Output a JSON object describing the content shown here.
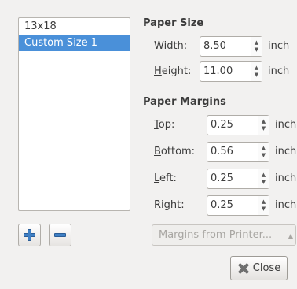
{
  "sizes": [
    {
      "label": "13x18",
      "selected": false
    },
    {
      "label": "Custom Size 1",
      "selected": true
    }
  ],
  "paper_size": {
    "heading": "Paper Size",
    "width": {
      "label_accel": "W",
      "label_rest": "idth:",
      "value": "8.50",
      "unit": "inch"
    },
    "height": {
      "label_accel": "H",
      "label_rest": "eight:",
      "value": "11.00",
      "unit": "inch"
    }
  },
  "paper_margins": {
    "heading": "Paper Margins",
    "top": {
      "label_accel": "T",
      "label_rest": "op:",
      "value": "0.25",
      "unit": "inch"
    },
    "bottom": {
      "label_accel": "B",
      "label_rest": "ottom:",
      "value": "0.56",
      "unit": "inch"
    },
    "left": {
      "label_accel": "L",
      "label_rest": "eft:",
      "value": "0.25",
      "unit": "inch"
    },
    "right": {
      "label_accel": "R",
      "label_rest": "ight:",
      "value": "0.25",
      "unit": "inch"
    }
  },
  "buttons": {
    "add_icon": "plus-icon",
    "remove_icon": "minus-icon",
    "margins_from_printer": "Margins from Printer...",
    "close_accel": "C",
    "close_rest": "lose"
  },
  "icons": {
    "spin": "spin-arrows-icon",
    "close": "close-x-icon",
    "dropdown": "dropdown-arrows-icon"
  },
  "colors": {
    "selection": "#4a90d9",
    "accent_blue": "#3f7fc4",
    "background": "#f2f1f0"
  }
}
